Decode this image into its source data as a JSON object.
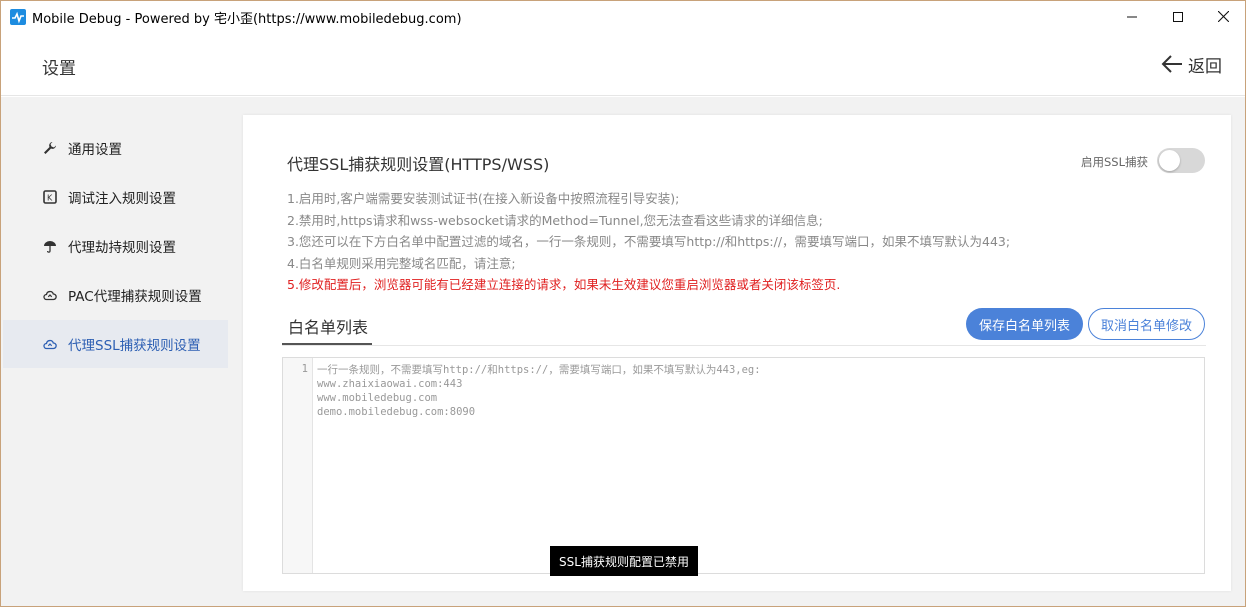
{
  "window": {
    "title": "Mobile Debug - Powered by 宅小歪(https://www.mobiledebug.com)",
    "controls": [
      "minimize",
      "maximize",
      "close"
    ]
  },
  "header": {
    "title": "设置",
    "back_label": "返回"
  },
  "sidebar": {
    "items": [
      {
        "label": "通用设置",
        "icon": "wrench-icon",
        "active": false
      },
      {
        "label": "调试注入规则设置",
        "icon": "inject-icon",
        "active": false
      },
      {
        "label": "代理劫持规则设置",
        "icon": "umbrella-icon",
        "active": false
      },
      {
        "label": "PAC代理捕获规则设置",
        "icon": "cloud-upload-icon",
        "active": false
      },
      {
        "label": "代理SSL捕获规则设置",
        "icon": "cloud-upload-icon",
        "active": true
      }
    ]
  },
  "panel": {
    "title": "代理SSL捕获规则设置(HTTPS/WSS)",
    "toggle_label": "启用SSL捕获",
    "toggle_on": false,
    "notes": [
      "1.启用时,客户端需要安装测试证书(在接入新设备中按照流程引导安装);",
      "2.禁用时,https请求和wss-websocket请求的Method=Tunnel,您无法查看这些请求的详细信息;",
      "3.您还可以在下方白名单中配置过滤的域名，一行一条规则，不需要填写http://和https://，需要填写端口，如果不填写默认为443;",
      "4.白名单规则采用完整域名匹配，请注意;"
    ],
    "warning": "5.修改配置后，浏览器可能有已经建立连接的请求，如果未生效建议您重启浏览器或者关闭该标签页.",
    "tab_label": "白名单列表",
    "save_label": "保存白名单列表",
    "cancel_label": "取消白名单修改",
    "editor": {
      "line_number": "1",
      "placeholder": "一行一条规则，不需要填写http://和https://，需要填写端口，如果不填写默认为443,eg:\nwww.zhaixiaowai.com:443\nwww.mobiledebug.com\ndemo.mobiledebug.com:8090"
    }
  },
  "toast": {
    "message": "SSL捕获规则配置已禁用"
  },
  "colors": {
    "accent": "#4b82d9",
    "warning": "#e02020",
    "active_bg": "#e7eaf0"
  }
}
